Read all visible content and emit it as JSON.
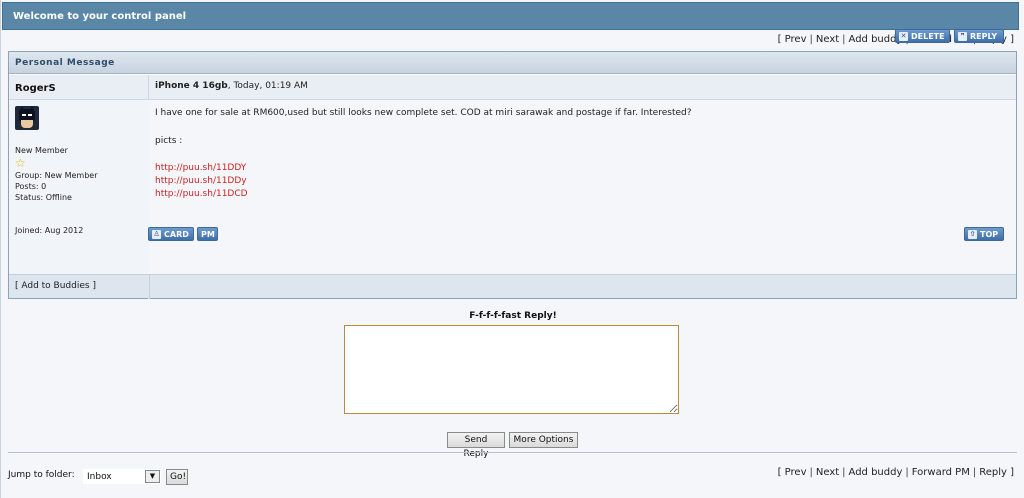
{
  "header": {
    "title": "Welcome to your control panel"
  },
  "nav": {
    "prev": "Prev",
    "next": "Next",
    "add_buddy": "Add buddy",
    "forward_pm": "Forward PM",
    "reply": "Reply"
  },
  "pm": {
    "section_title": "Personal Message",
    "author": "RogerS",
    "subject": "iPhone 4 16gb",
    "date": ", Today, 01:19 AM",
    "delete_label": "DELETE",
    "reply_label": "REPLY",
    "member_title": "New Member",
    "group": "Group: New Member",
    "posts": "Posts: 0",
    "status": "Status: Offline",
    "joined": "Joined: Aug 2012",
    "body_line1": "I have one for sale at RM600,used but still looks new complete set. COD at miri sarawak and postage if far. Interested?",
    "body_line2": "picts :",
    "links": [
      "http://puu.sh/11DDY",
      "http://puu.sh/11DDy",
      "http://puu.sh/11DCD"
    ],
    "add_to_buddies": "[ Add to Buddies ]",
    "card_label": "CARD",
    "pm_label": "PM",
    "top_label": "TOP"
  },
  "fast_reply": {
    "label": "F-f-f-f-fast Reply!",
    "textarea_value": "",
    "send_label": "Send Reply",
    "more_label": "More Options"
  },
  "jump": {
    "label": "Jump to folder:",
    "selected": "Inbox",
    "go_label": "Go!"
  },
  "icons": {
    "delete": "close-x-icon",
    "reply": "quote-icon",
    "card": "user-card-icon",
    "top": "arrow-up-icon",
    "star": "star-icon",
    "dropdown": "chevron-down-icon"
  },
  "colors": {
    "title_bar": "#5a87a8",
    "link_red": "#cc2222",
    "button_blue": "#3f6fa8",
    "star_gold": "#e4b400"
  }
}
